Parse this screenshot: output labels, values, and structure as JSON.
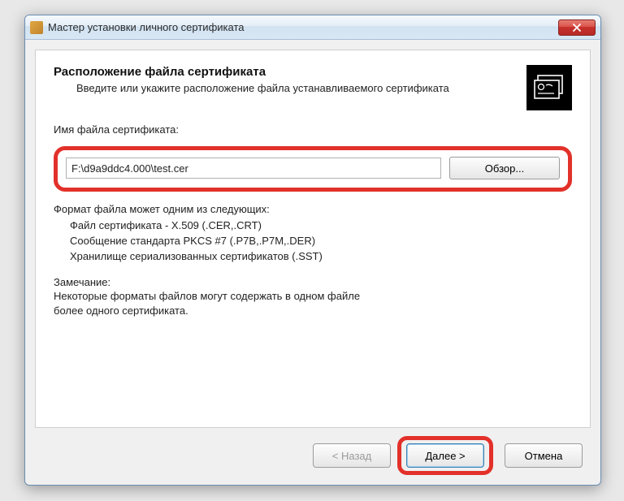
{
  "window": {
    "title": "Мастер установки личного сертификата"
  },
  "header": {
    "title": "Расположение файла сертификата",
    "subtitle": "Введите или укажите расположение файла устанавливаемого сертификата"
  },
  "file": {
    "label": "Имя файла сертификата:",
    "value": "F:\\d9a9ddc4.000\\test.cer",
    "browse_label": "Обзор..."
  },
  "formats": {
    "heading": "Формат файла может одним из следующих:",
    "items": [
      "Файл сертификата - X.509 (.CER,.CRT)",
      "Сообщение стандарта PKCS #7 (.P7B,.P7M,.DER)",
      "Хранилище сериализованных сертификатов (.SST)"
    ]
  },
  "note": {
    "label": "Замечание:",
    "text": "Некоторые форматы файлов могут содержать в одном файле\nболее одного сертификата."
  },
  "buttons": {
    "back": "< Назад",
    "next": "Далее >",
    "cancel": "Отмена"
  }
}
